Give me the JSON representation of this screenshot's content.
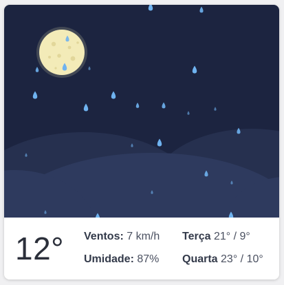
{
  "weather": {
    "condition_icon": "moon-rain-icon",
    "colors": {
      "sky": "#1c2440",
      "hill_back": "#26304f",
      "hill_front": "#2e3a5e",
      "moon": "#f3ebb8",
      "rain": "#6fb3f0"
    },
    "temperature": "12°",
    "wind": {
      "label": "Ventos:",
      "value": "7 km/h"
    },
    "humidity": {
      "label": "Umidade:",
      "value": "87%"
    },
    "forecast": [
      {
        "day": "Terça",
        "range": "21° / 9°"
      },
      {
        "day": "Quarta",
        "range": "23° / 10°"
      }
    ]
  }
}
